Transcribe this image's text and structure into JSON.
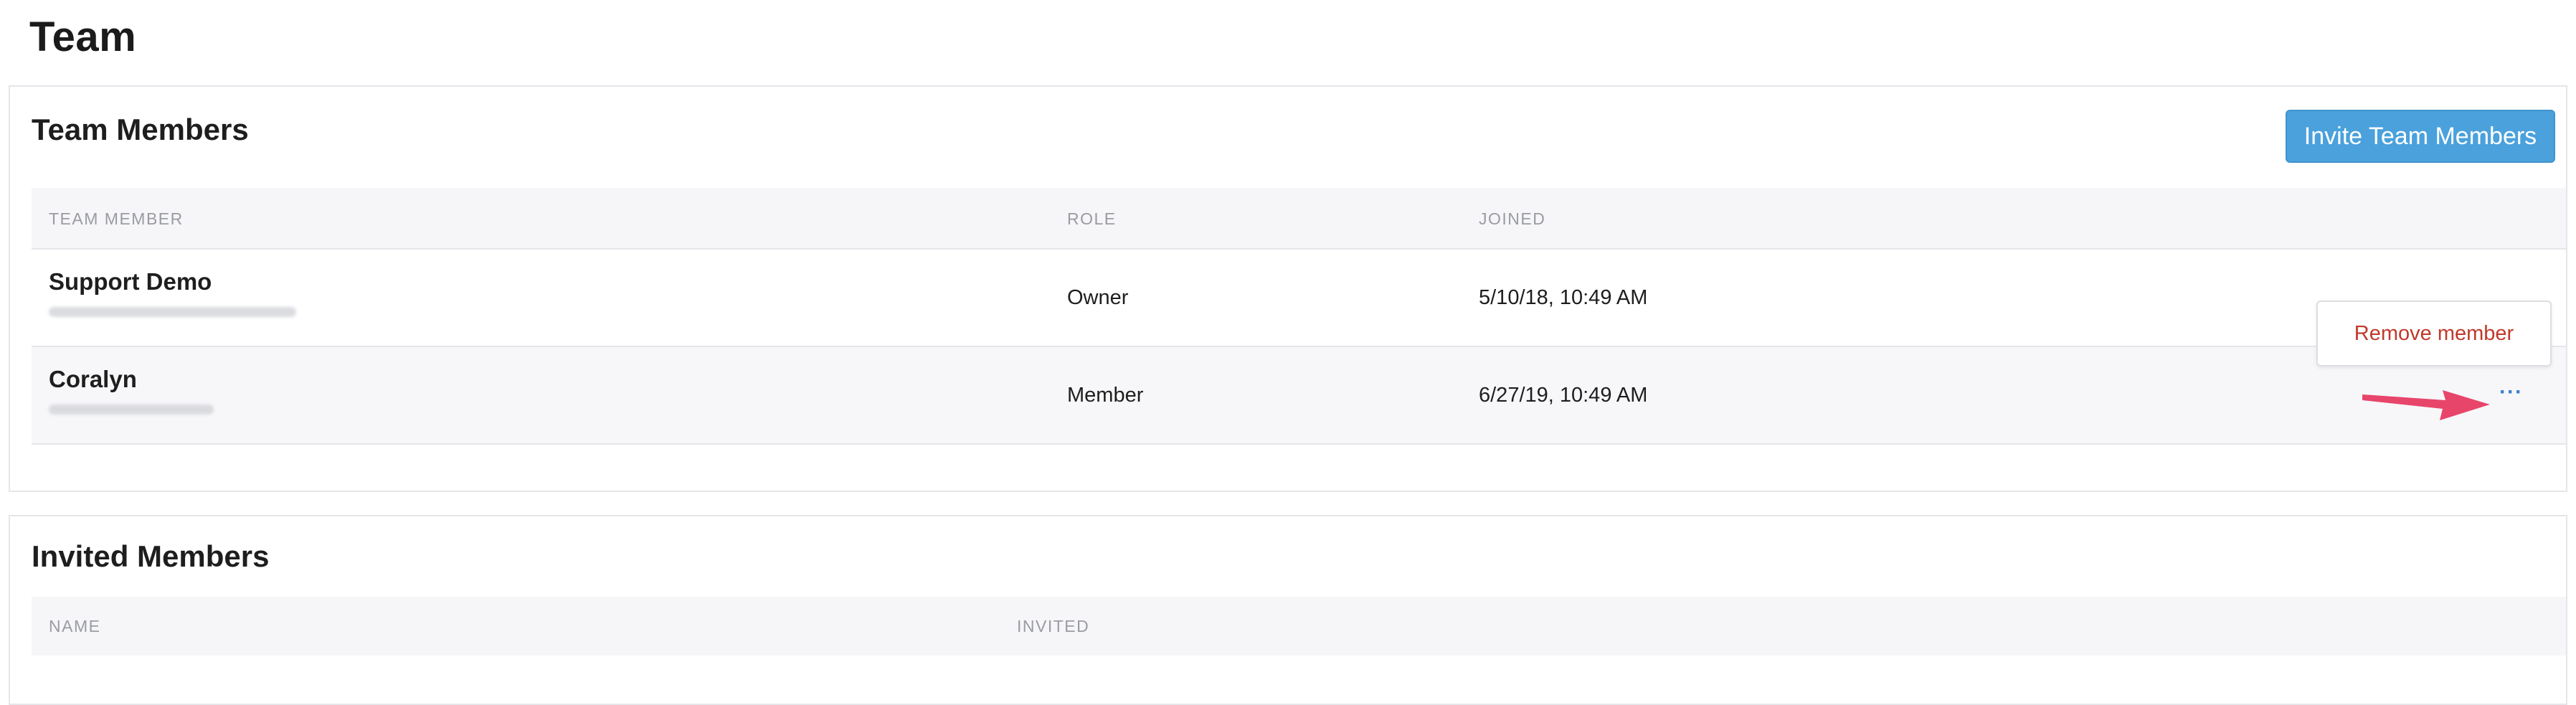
{
  "page": {
    "title": "Team"
  },
  "team_members": {
    "title": "Team Members",
    "invite_button": "Invite Team Members",
    "columns": [
      "TEAM MEMBER",
      "ROLE",
      "JOINED"
    ],
    "rows": [
      {
        "name": "Support Demo",
        "role": "Owner",
        "joined": "5/10/18, 10:49 AM"
      },
      {
        "name": "Coralyn",
        "role": "Member",
        "joined": "6/27/19, 10:49 AM"
      }
    ],
    "row_menu": {
      "trigger": "···",
      "remove_label": "Remove member"
    }
  },
  "invited_members": {
    "title": "Invited Members",
    "columns": [
      "NAME",
      "INVITED"
    ]
  },
  "colors": {
    "accent": "#4aa1dc",
    "danger": "#c0392b",
    "annotation_arrow": "#e8456b"
  }
}
